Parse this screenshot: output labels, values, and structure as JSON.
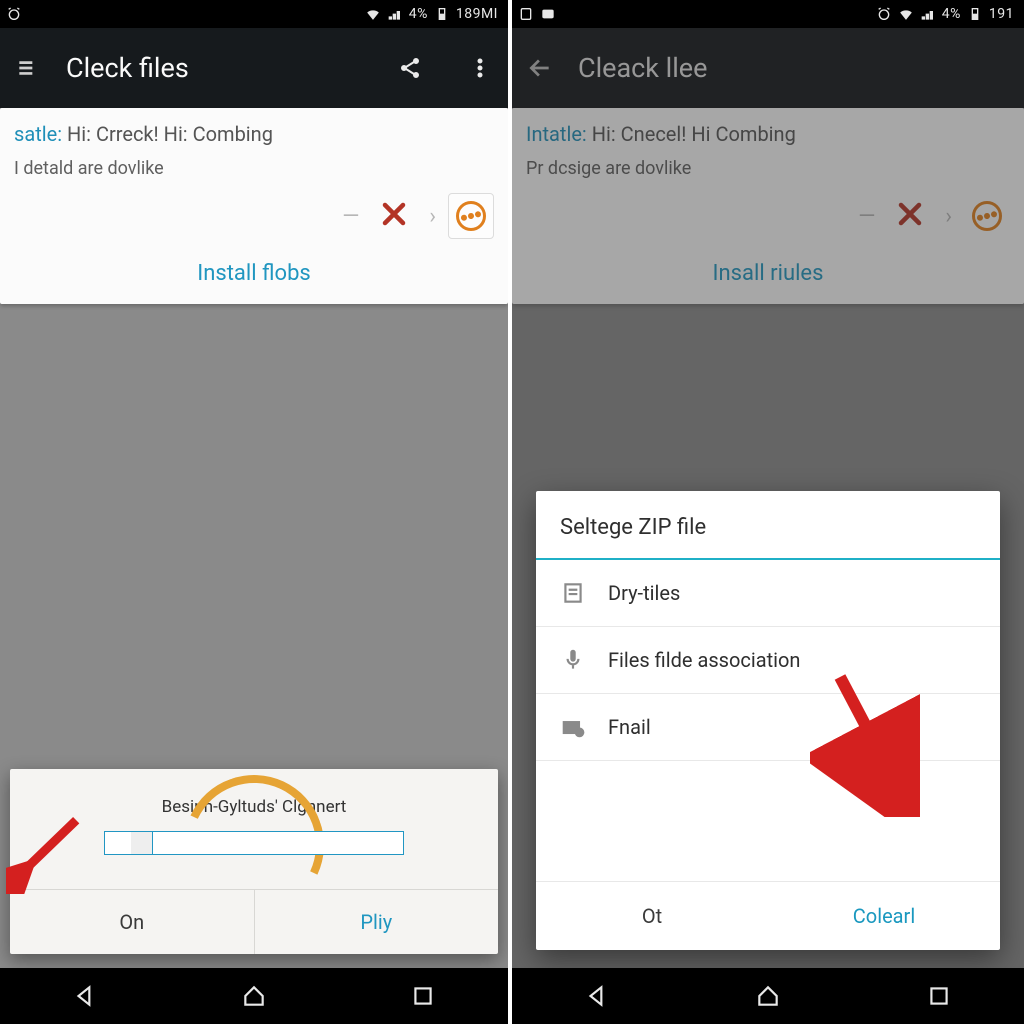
{
  "left": {
    "status": {
      "pct": "4%",
      "time": "189MI"
    },
    "appbar": {
      "title": "Cleck files"
    },
    "card": {
      "line1a": "satle:",
      "line1b": " Hi: Crreck! Hi: Combing",
      "line2": "I detald are dovlike",
      "link": "Install flobs"
    },
    "dialog": {
      "label": "Besipn-Gyltuds' Clgnnert",
      "ok": "On",
      "play": "Pliy"
    }
  },
  "right": {
    "status": {
      "pct": "4%",
      "time": "191"
    },
    "appbar": {
      "title": "Cleack llee"
    },
    "card": {
      "line1a": "Intatle:",
      "line1b": " Hi: Cnecel! Hi Combing",
      "line2": "Pr dcsige are dovlike",
      "link": "Insall riules"
    },
    "dialog": {
      "title": "Seltege ZIP file",
      "items": [
        "Dry-tiles",
        "Files filde association",
        "Fnail"
      ],
      "ok": "Ot",
      "action": "Colearl"
    }
  }
}
